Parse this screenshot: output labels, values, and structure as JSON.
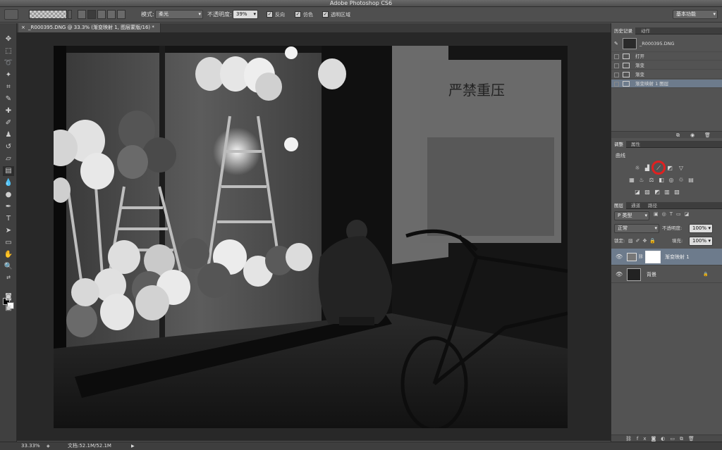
{
  "app": {
    "title": "Adobe Photoshop CS6"
  },
  "options": {
    "mode_label": "模式:",
    "mode_value": "柔光",
    "opacity_label": "不透明度:",
    "opacity_value": "39%",
    "reverse_label": "反向",
    "dither_label": "仿色",
    "transparency_label": "透明区域",
    "workspace_value": "基本功能"
  },
  "document": {
    "tab_title": "_R000395.DNG @ 33.3% (渐变映射 1, 图层蒙版/16) *",
    "close_glyph": "×",
    "photo_text": "严禁重压"
  },
  "status": {
    "zoom": "33.33%",
    "doc_info": "文档:52.1M/52.1M"
  },
  "history": {
    "tabs": [
      "历史记录",
      "动作"
    ],
    "snapshot": "_R000395.DNG",
    "items": [
      {
        "label": "打开"
      },
      {
        "label": "渐变"
      },
      {
        "label": "渐变"
      },
      {
        "label": "渐变映射 1 图层"
      }
    ]
  },
  "adjustments": {
    "tabs": [
      "调整",
      "属性"
    ],
    "title": "曲线"
  },
  "layers": {
    "tabs": [
      "图层",
      "通道",
      "路径"
    ],
    "filter_value": "P 类型",
    "blend_value": "正常",
    "opacity_label": "不透明度:",
    "opacity_value": "100%",
    "lock_label": "锁定:",
    "fill_label": "填充:",
    "fill_value": "100%",
    "items": [
      {
        "name": "渐变映射 1"
      },
      {
        "name": "背景"
      }
    ]
  },
  "colors": {
    "selection": "#6d7b8c",
    "highlight_circle": "#e02020"
  }
}
